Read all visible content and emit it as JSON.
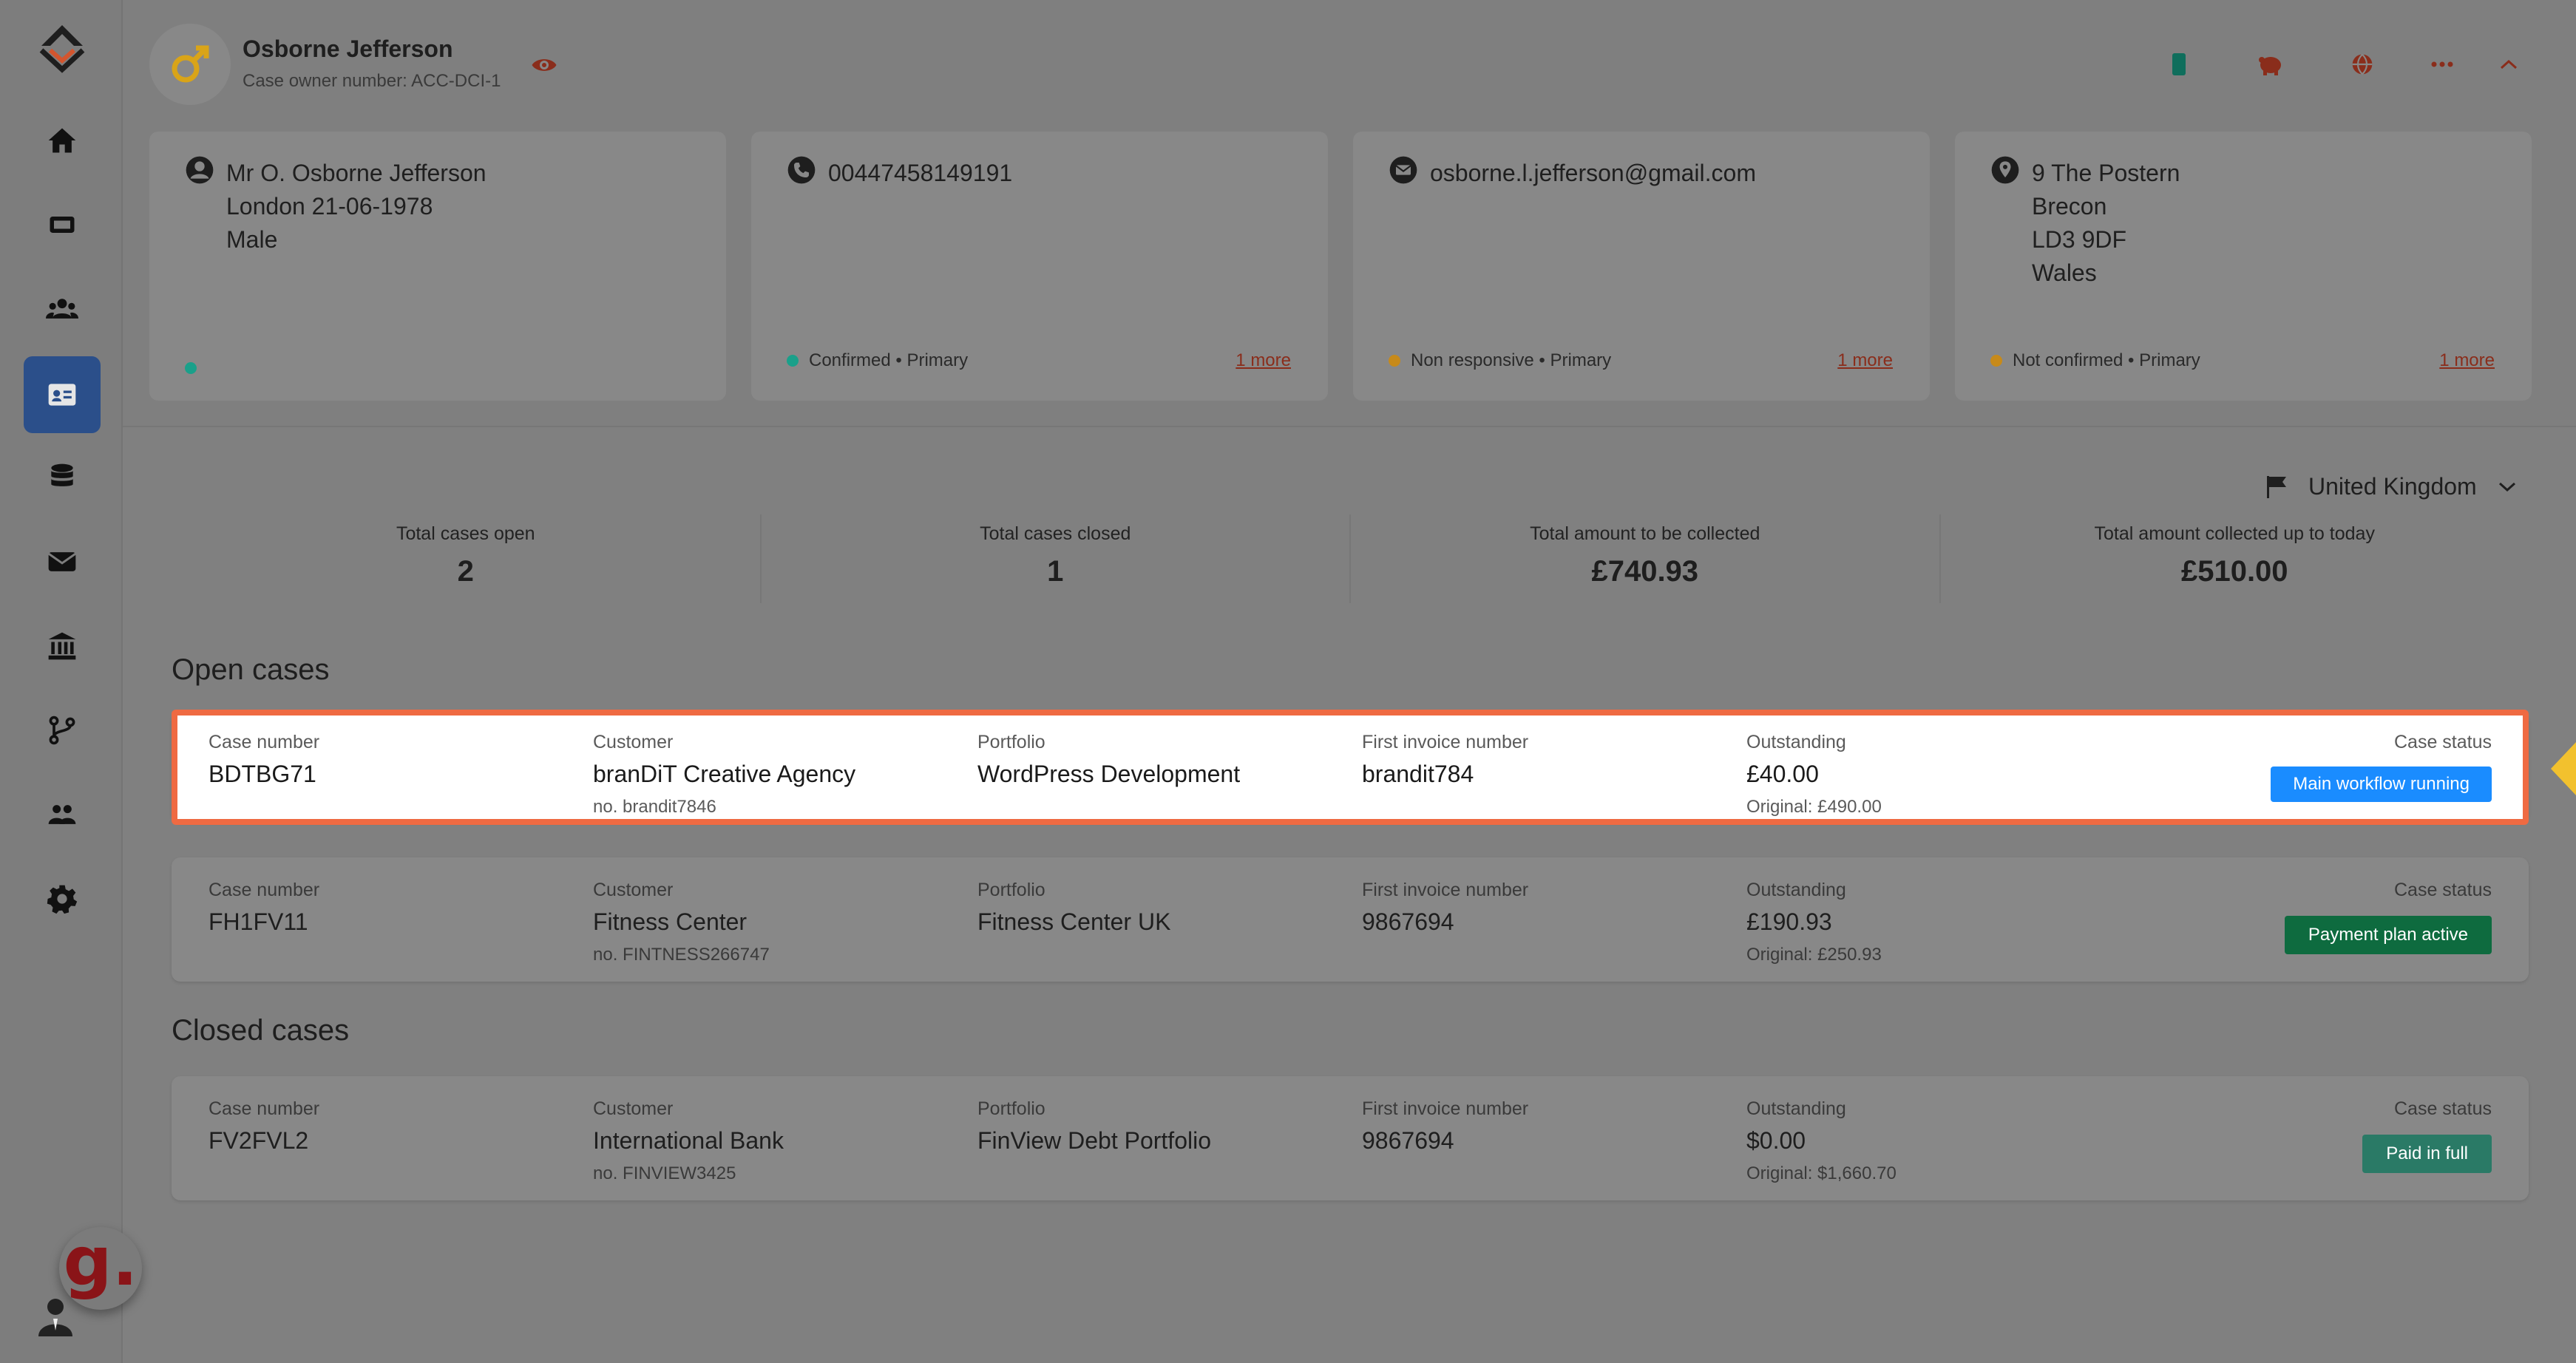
{
  "profile": {
    "name": "Osborne Jefferson",
    "owner_number": "Case owner number: ACC-DCI-1"
  },
  "info_cards": {
    "person": {
      "line1": "Mr O. Osborne Jefferson",
      "line2": "London 21-06-1978",
      "line3": "Male",
      "dot_color": "#1aa08a"
    },
    "phone": {
      "line1": "00447458149191",
      "status": "Confirmed • Primary",
      "more": "1 more",
      "dot_color": "#1aa08a"
    },
    "email": {
      "line1": "osborne.l.jefferson@gmail.com",
      "status": "Non responsive • Primary",
      "more": "1 more",
      "dot_color": "#c78a1a"
    },
    "address": {
      "line1": "9 The Postern",
      "line2": "Brecon",
      "line3": "LD3 9DF",
      "line4": "Wales",
      "status": "Not confirmed • Primary",
      "more": "1 more",
      "dot_color": "#c78a1a"
    }
  },
  "country": "United Kingdom",
  "stats": [
    {
      "label": "Total cases open",
      "value": "2"
    },
    {
      "label": "Total cases closed",
      "value": "1"
    },
    {
      "label": "Total amount to be collected",
      "value": "£740.93"
    },
    {
      "label": "Total amount collected up to today",
      "value": "£510.00"
    }
  ],
  "labels": {
    "open_cases": "Open cases",
    "closed_cases": "Closed cases",
    "case_number": "Case number",
    "customer": "Customer",
    "portfolio": "Portfolio",
    "first_invoice": "First invoice number",
    "outstanding": "Outstanding",
    "case_status": "Case status"
  },
  "open_cases": [
    {
      "case_number": "BDTBG71",
      "customer": "branDiT Creative Agency",
      "customer_no": "no.  brandit7846",
      "portfolio": "WordPress Development",
      "first_invoice": "brandit784",
      "outstanding": "£40.00",
      "original": "Original:  £490.00",
      "status": "Main workflow running",
      "status_color": "#1a8cff"
    },
    {
      "case_number": "FH1FV11",
      "customer": "Fitness Center",
      "customer_no": "no.  FINTNESS266747",
      "portfolio": "Fitness Center UK",
      "first_invoice": "9867694",
      "outstanding": "£190.93",
      "original": "Original:  £250.93",
      "status": "Payment plan active",
      "status_color": "#0e6b3f"
    }
  ],
  "closed_cases": [
    {
      "case_number": "FV2FVL2",
      "customer": "International Bank",
      "customer_no": "no.  FINVIEW3425",
      "portfolio": "FinView Debt Portfolio",
      "first_invoice": "9867694",
      "outstanding": "$0.00",
      "original": "Original:  $1,660.70",
      "status": "Paid in full",
      "status_color": "#2a7a66"
    }
  ],
  "icons": [
    "home-icon",
    "ticket-icon",
    "users-icon",
    "contact-card-icon",
    "database-icon",
    "mail-icon",
    "bank-icon",
    "branch-icon",
    "team-icon",
    "gear-icon"
  ],
  "badge_letter": "g."
}
